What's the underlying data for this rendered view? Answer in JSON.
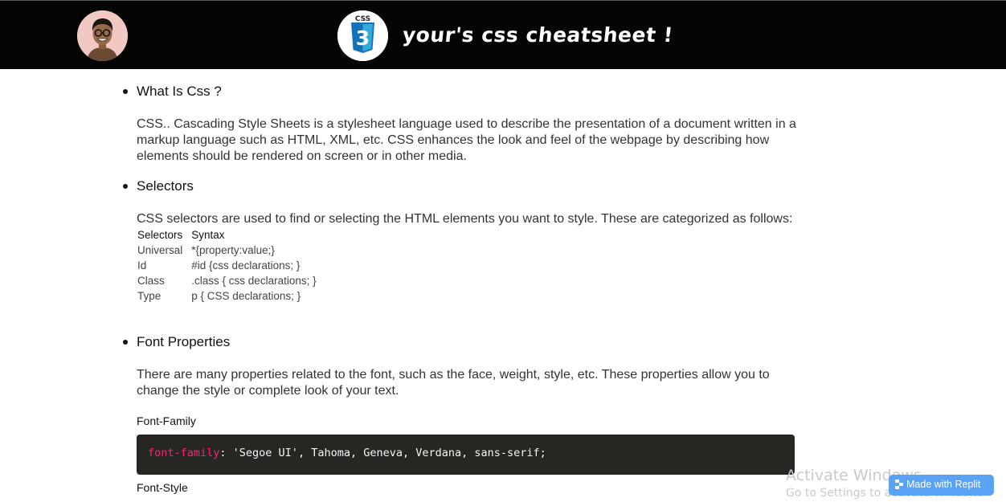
{
  "header": {
    "avatar_icon": "avatar-icon",
    "logo_icon": "css3-logo-icon",
    "logo_text": "CSS",
    "logo_number": "3",
    "title": "your's css cheatsheet !",
    "background": "#050505"
  },
  "sections": [
    {
      "heading": "What Is Css ?",
      "paragraph": "CSS.. Cascading Style Sheets is a stylesheet language used to describe the presentation of a document written in a markup language such as HTML, XML, etc. CSS enhances the look and feel of the webpage by describing how elements should be rendered on screen or in other media."
    },
    {
      "heading": "Selectors",
      "paragraph": "CSS selectors are used to find or selecting the HTML elements you want to style. These are categorized as follows:",
      "table": {
        "headers": [
          "Selectors",
          "Syntax"
        ],
        "rows": [
          [
            "Universal",
            "*{property:value;}"
          ],
          [
            "Id",
            "#id {css declarations; }"
          ],
          [
            "Class",
            ".class { css declarations; }"
          ],
          [
            "Type",
            "p { CSS declarations; }"
          ]
        ]
      }
    },
    {
      "heading": "Font Properties",
      "paragraph": "There are many properties related to the font, such as the face, weight, style, etc. These properties allow you to change the style or complete look of your text.",
      "subsections": [
        {
          "title": "Font-Family",
          "code_property": "font-family",
          "code_value": ": 'Segoe UI', Tahoma, Geneva, Verdana, sans-serif;"
        },
        {
          "title": "Font-Style"
        }
      ]
    }
  ],
  "watermark": {
    "line1": "Activate Windows",
    "line2": "Go to Settings to activate Windows."
  },
  "replit_badge": {
    "label": "Made with Replit",
    "icon": "replit-icon",
    "color": "#5aa2f5"
  },
  "colors": {
    "code_background": "#262623",
    "code_property": "#f92672",
    "css_logo_blue": "#1572b6"
  }
}
